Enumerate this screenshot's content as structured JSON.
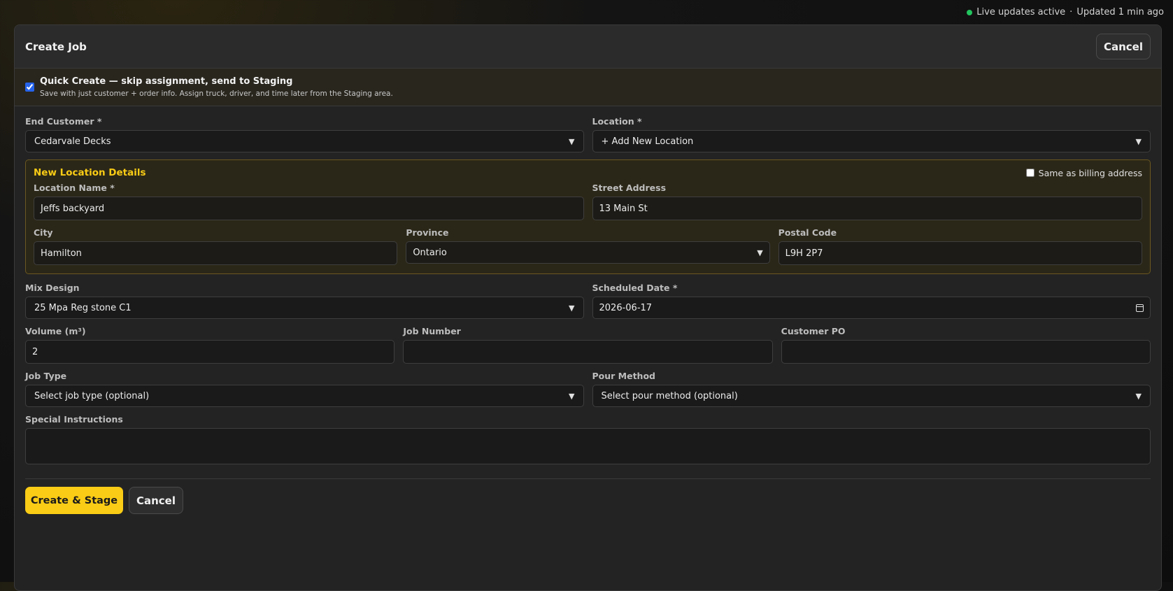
{
  "status": {
    "live_text": "Live updates active",
    "separator": "·",
    "updated_text": "Updated 1 min ago"
  },
  "header": {
    "title": "Create Job",
    "cancel_label": "Cancel"
  },
  "quick_create": {
    "checked": true,
    "title": "Quick Create — skip assignment, send to Staging",
    "subtitle": "Save with just customer + order info. Assign truck, driver, and time later from the Staging area."
  },
  "fields": {
    "end_customer": {
      "label": "End Customer *",
      "value": "Cedarvale Decks"
    },
    "location": {
      "label": "Location *",
      "value": "+ Add New Location"
    },
    "mix_design": {
      "label": "Mix Design",
      "value": "25 Mpa Reg stone C1"
    },
    "scheduled_date": {
      "label": "Scheduled Date *",
      "value": "2026-06-17"
    },
    "volume": {
      "label": "Volume (m³)",
      "value": "2"
    },
    "job_number": {
      "label": "Job Number",
      "value": ""
    },
    "customer_po": {
      "label": "Customer PO",
      "value": ""
    },
    "job_type": {
      "label": "Job Type",
      "value": "Select job type (optional)"
    },
    "pour_method": {
      "label": "Pour Method",
      "value": "Select pour method (optional)"
    },
    "special_instructions": {
      "label": "Special Instructions",
      "value": ""
    }
  },
  "new_location": {
    "title": "New Location Details",
    "same_as_billing_label": "Same as billing address",
    "location_name": {
      "label": "Location Name *",
      "value": "Jeffs backyard"
    },
    "street_address": {
      "label": "Street Address",
      "value": "13 Main St"
    },
    "city": {
      "label": "City",
      "value": "Hamilton"
    },
    "province": {
      "label": "Province",
      "value": "Ontario"
    },
    "postal_code": {
      "label": "Postal Code",
      "value": "L9H 2P7"
    }
  },
  "actions": {
    "primary_label": "Create & Stage",
    "cancel_label": "Cancel"
  },
  "colors": {
    "accent": "#facc15",
    "live": "#22c55e"
  }
}
